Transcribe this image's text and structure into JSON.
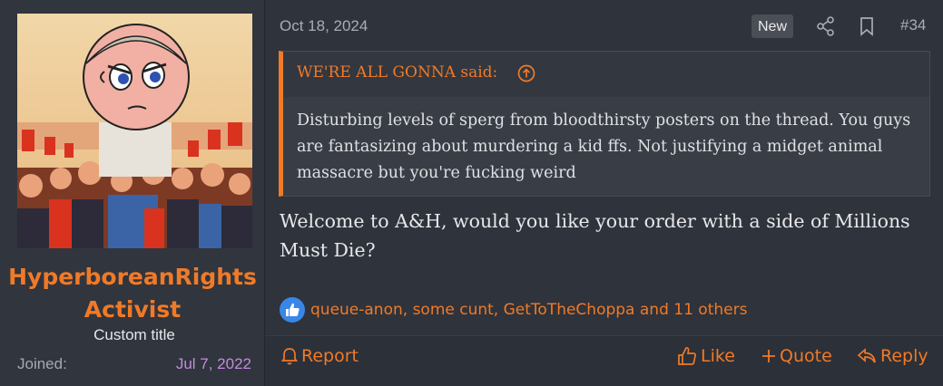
{
  "user": {
    "username": "HyperboreanRights Activist",
    "custom_title": "Custom title",
    "joined_label": "Joined:",
    "joined_date": "Jul 7, 2022"
  },
  "post": {
    "date": "Oct 18, 2024",
    "new_badge": "New",
    "number": "#34",
    "quote": {
      "author": "WE'RE ALL GONNA said:",
      "text": "Disturbing levels of sperg from bloodthirsty posters on the thread. You guys are fantasizing about murdering a kid ffs. Not justifying a midget animal massacre but you're fucking weird"
    },
    "message": "Welcome to A&H, would you like your order with a side of Millions Must Die?",
    "reactions": "queue-anon, some cunt, GetToTheChoppa and 11 others"
  },
  "actions": {
    "report": "Report",
    "like": "Like",
    "quote": "Quote",
    "reply": "Reply"
  },
  "colors": {
    "accent": "#f07a28",
    "joined_date": "#c48ae0",
    "background": "#2f333b"
  }
}
